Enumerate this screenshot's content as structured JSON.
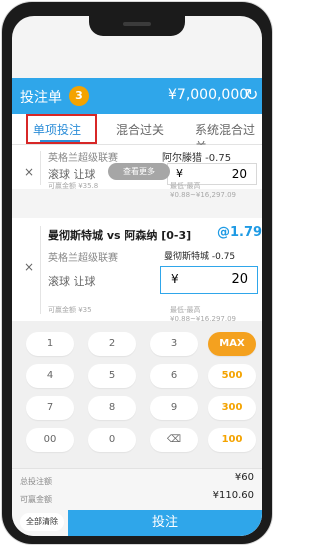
{
  "header": {
    "title": "投注单",
    "badge": "3",
    "amount": "¥7,000,000",
    "refresh_icon": "refresh-icon"
  },
  "tabs": [
    {
      "label": "单项投注"
    },
    {
      "label": "混合过关"
    },
    {
      "label": "系统混合过关"
    }
  ],
  "tooltip": "查看更多",
  "bets": [
    {
      "league": "英格兰超级联赛",
      "team_line": "阿尔滕猎 -0.75",
      "type": "滚球 让球",
      "stake": "20",
      "footer_left": "可赢金额 ¥35.8",
      "footer_right": "最低-最高 ¥0.88~¥16,297.09"
    },
    {
      "matchup": "曼彻斯特城 vs 阿森纳 [0-3]",
      "odds": "@1.79",
      "league": "英格兰超级联赛",
      "team_line": "曼彻斯特城 -0.75",
      "type": "滚球 让球",
      "stake": "20",
      "footer_left": "可赢金额 ¥35",
      "footer_right": "最低-最高 ¥0.88~¥16,297.09"
    }
  ],
  "keypad": {
    "row1": [
      "1",
      "2",
      "3",
      "MAX"
    ],
    "row2": [
      "4",
      "5",
      "6",
      "500"
    ],
    "row3": [
      "7",
      "8",
      "9",
      "300"
    ],
    "row4": [
      "00",
      "0",
      "⌫",
      "100"
    ]
  },
  "summary": {
    "total_label": "总投注额",
    "total_value": "¥60",
    "win_label": "可赢金额",
    "win_value": "¥110.60"
  },
  "footer": {
    "clear_label": "全部清除",
    "place_label": "投注"
  },
  "currency": "¥"
}
